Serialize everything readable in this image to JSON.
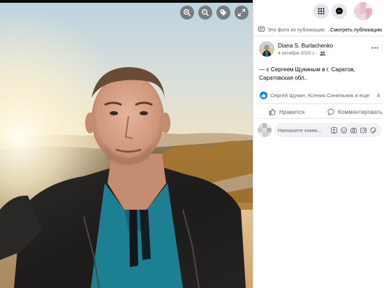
{
  "viewer": {
    "tools": [
      {
        "name": "zoom-in-icon"
      },
      {
        "name": "zoom-out-icon"
      },
      {
        "name": "tag-icon"
      },
      {
        "name": "fullscreen-icon"
      }
    ]
  },
  "header": {
    "menu_icon": "grid-menu-icon",
    "messenger_icon": "messenger-icon"
  },
  "notice": {
    "text": "Это фото из публикации.",
    "link": "Смотреть публикацию"
  },
  "post": {
    "author": "Diana S. Burlachenko",
    "date": "4 октября 2020 г. ·",
    "audience_icon": "friends-icon",
    "text_prefix": "— с ",
    "tagged_person": "Сергеем Щукиным",
    "text_middle": " в ",
    "tagged_place": "г. Саратов, Саратовская обл.",
    "text_suffix": "."
  },
  "reactions": {
    "icon": "like-reaction-icon",
    "names": "Сергей Щукин, Ксения Синельник и еще",
    "count": "4"
  },
  "actions": {
    "like_label": "Нравится",
    "comment_label": "Комментировать"
  },
  "comment": {
    "placeholder": "Напишите комм..."
  },
  "colors": {
    "accent": "#1877f2",
    "secondary_text": "#65676b",
    "primary_text": "#050505",
    "divider": "#e4e6eb",
    "input_bg": "#f0f2f5"
  }
}
